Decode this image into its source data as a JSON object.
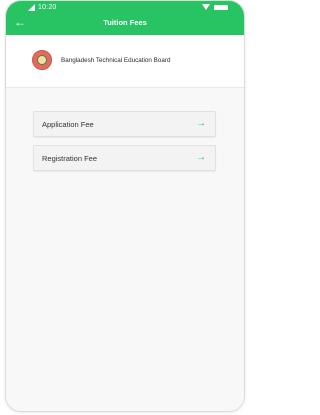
{
  "status_bar": {
    "time": "10:20"
  },
  "header": {
    "title": "Tuition Fees",
    "back_icon": "←"
  },
  "board": {
    "name": "Bangladesh Technical Education Board"
  },
  "fees": [
    {
      "label": "Application Fee",
      "arrow_icon": "→"
    },
    {
      "label": "Registration Fee",
      "arrow_icon": "→"
    }
  ],
  "colors": {
    "accent": "#28c363"
  }
}
